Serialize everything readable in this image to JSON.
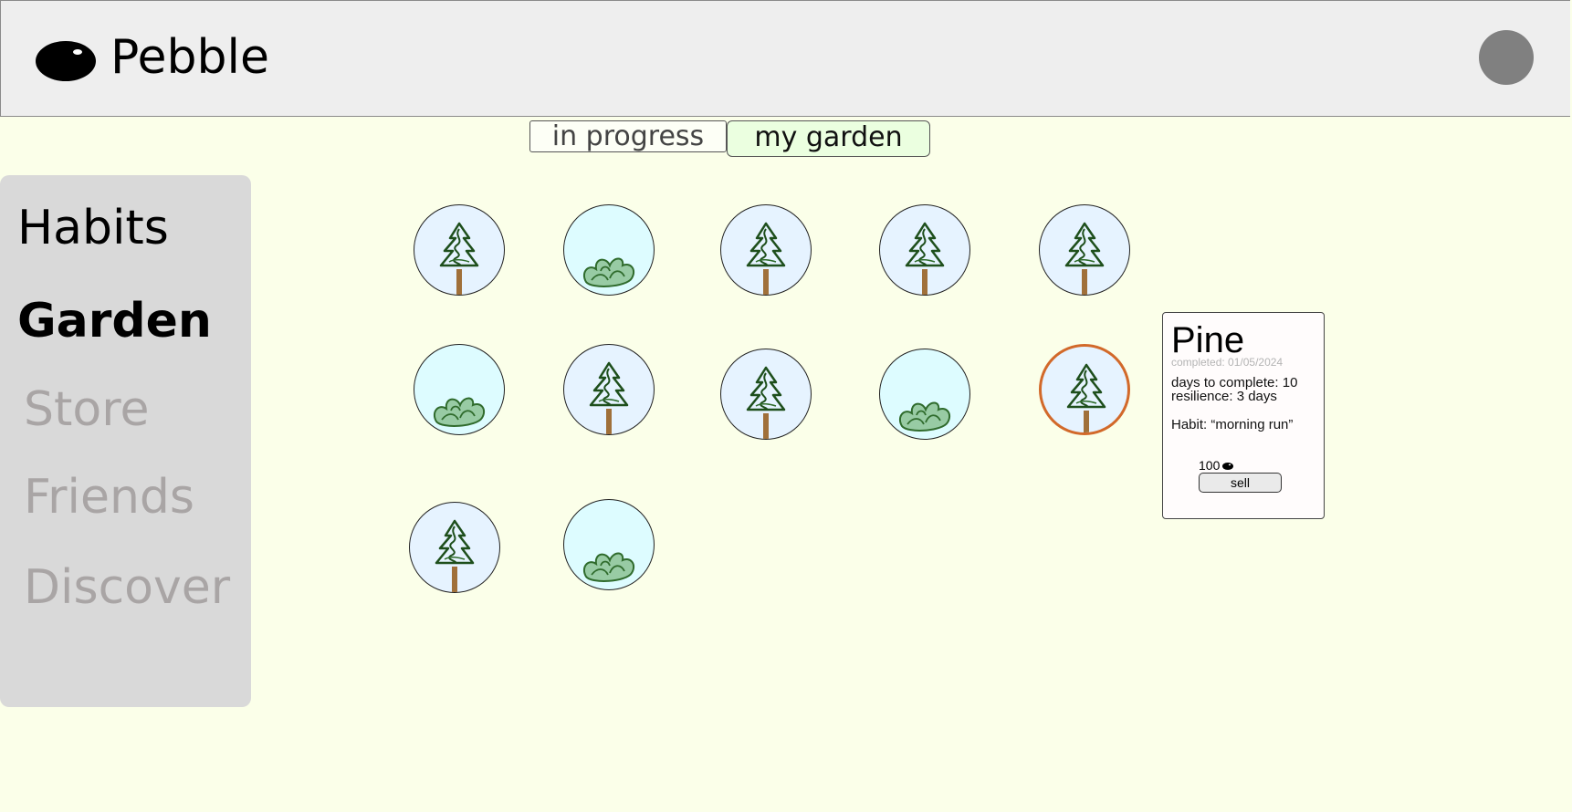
{
  "app": {
    "title": "Pebble",
    "logo_icon": "pebble-logo-icon"
  },
  "header": {
    "avatar_icon": "user-avatar-icon"
  },
  "tabs": [
    {
      "label": "in progress",
      "active": false
    },
    {
      "label": "my garden",
      "active": true
    }
  ],
  "sidebar": {
    "items": [
      {
        "label": "Habits",
        "active": false
      },
      {
        "label": "Garden",
        "active": true
      },
      {
        "label": "Store",
        "active": false
      },
      {
        "label": "Friends",
        "active": false
      },
      {
        "label": "Discover",
        "active": false
      }
    ]
  },
  "garden": {
    "plants": [
      {
        "kind": "pine",
        "icon": "pine-tree-icon",
        "selected": false
      },
      {
        "kind": "bush",
        "icon": "bush-icon",
        "selected": false
      },
      {
        "kind": "pine",
        "icon": "pine-tree-icon",
        "selected": false
      },
      {
        "kind": "pine",
        "icon": "pine-tree-icon",
        "selected": false
      },
      {
        "kind": "pine",
        "icon": "pine-tree-icon",
        "selected": false
      },
      {
        "kind": "bush",
        "icon": "bush-icon",
        "selected": false
      },
      {
        "kind": "pine",
        "icon": "pine-tree-icon",
        "selected": false
      },
      {
        "kind": "pine",
        "icon": "pine-tree-icon",
        "selected": false
      },
      {
        "kind": "bush",
        "icon": "bush-icon",
        "selected": false
      },
      {
        "kind": "pine",
        "icon": "pine-tree-icon",
        "selected": true
      },
      {
        "kind": "pine",
        "icon": "pine-tree-icon",
        "selected": false
      },
      {
        "kind": "bush",
        "icon": "bush-icon",
        "selected": false
      }
    ]
  },
  "detail": {
    "name": "Pine",
    "completed": "completed: 01/05/2024",
    "days_to_complete": "days to complete: 10",
    "resilience": "resilience: 3 days",
    "habit": "Habit: “morning run”",
    "price": "100",
    "coin_icon": "pebble-coin-icon",
    "sell_label": "sell"
  },
  "colors": {
    "background": "#fbffe9",
    "header": "#eeeeee",
    "sidebar": "#d9d9d9",
    "selected_border": "#d2692a",
    "active_tab": "#ebffe0"
  }
}
